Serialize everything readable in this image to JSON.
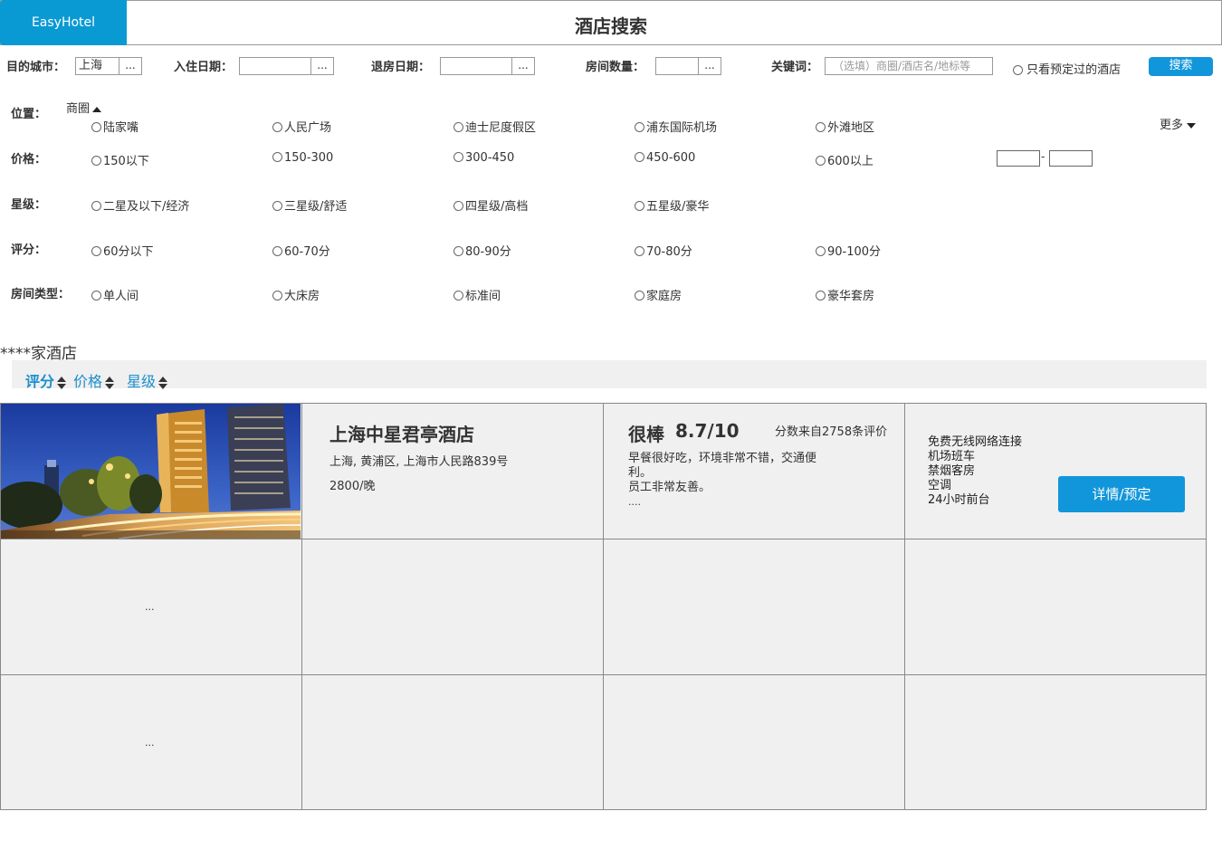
{
  "header": {
    "logo": "EasyHotel",
    "title": "酒店搜索"
  },
  "search": {
    "city_label": "目的城市：",
    "city_value": "上海",
    "checkin_label": "入住日期：",
    "checkin_value": "",
    "checkout_label": "退房日期：",
    "checkout_value": "",
    "rooms_label": "房间数量：",
    "rooms_value": "",
    "keyword_label": "关键词：",
    "keyword_placeholder": "（选填）商圈/酒店名/地标等",
    "dots": "...",
    "booked_only_label": "只看预定过的酒店",
    "search_button": "搜索"
  },
  "filters": {
    "location": {
      "label": "位置：",
      "sub_label": "商圈",
      "options": [
        "陆家嘴",
        "人民广场",
        "迪士尼度假区",
        "浦东国际机场",
        "外滩地区"
      ],
      "more": "更多"
    },
    "price": {
      "label": "价格：",
      "options": [
        "150以下",
        "150-300",
        "300-450",
        "450-600",
        "600以上"
      ],
      "range_sep": "-"
    },
    "star": {
      "label": "星级：",
      "options": [
        "二星及以下/经济",
        "三星级/舒适",
        "四星级/高档",
        "五星级/豪华"
      ]
    },
    "score": {
      "label": "评分：",
      "options": [
        "60分以下",
        "60-70分",
        "80-90分",
        "70-80分",
        "90-100分"
      ]
    },
    "room_type": {
      "label": "房间类型：",
      "options": [
        "单人间",
        "大床房",
        "标准间",
        "家庭房",
        "豪华套房"
      ]
    }
  },
  "results": {
    "count_text": "****家酒店",
    "sort": [
      "评分",
      "价格",
      "星级"
    ],
    "hotel": {
      "name": "上海中星君亭酒店",
      "address": "上海, 黄浦区, 上海市人民路839号",
      "price": "2800/晚",
      "rating_word": "很棒",
      "rating_score": "8.7/10",
      "review_count_text": "分数来自2758条评价",
      "review_line1": "早餐很好吃，环境非常不错，交通便",
      "review_line2": "利。",
      "review_line3": "员工非常友善。",
      "review_more": "....",
      "amenities": [
        "免费无线网络连接",
        "机场班车",
        "禁烟客房",
        "空调",
        "24小时前台"
      ],
      "detail_button": "详情/预定"
    },
    "placeholder_rows": [
      "...",
      "..."
    ]
  }
}
